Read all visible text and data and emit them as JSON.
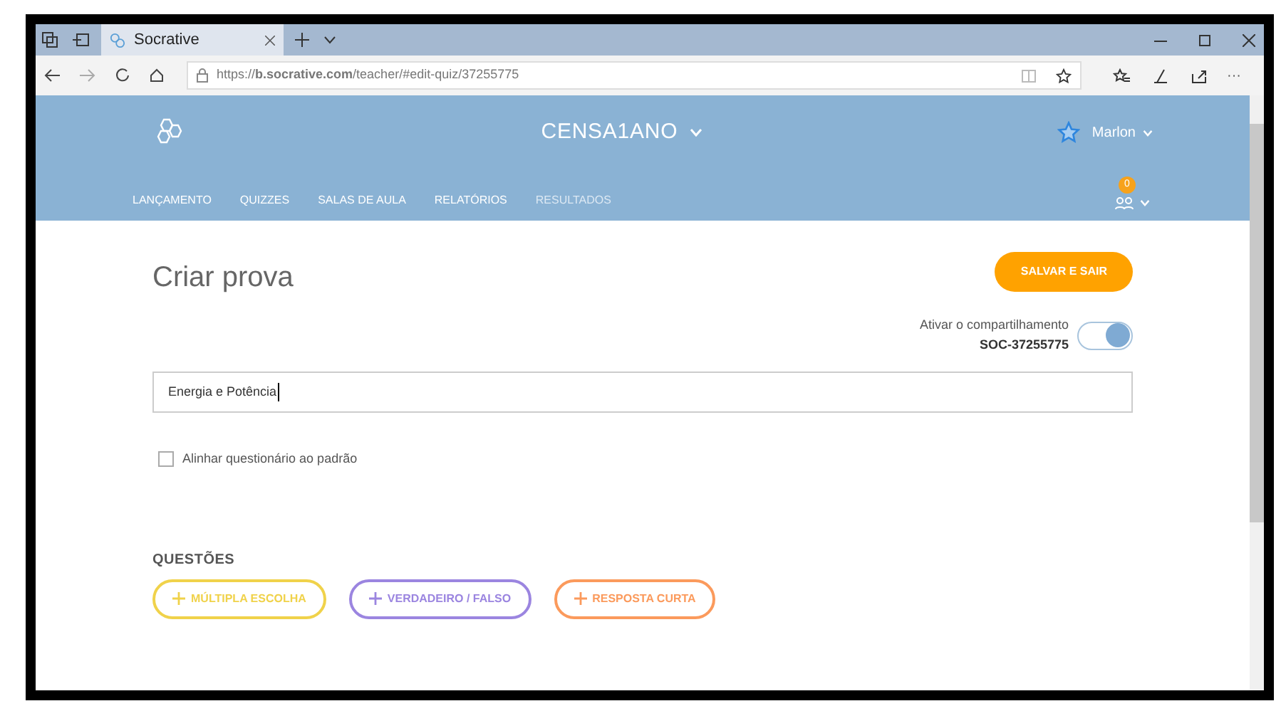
{
  "browser": {
    "tab_title": "Socrative",
    "url": "https://**b.socrative.com**/teacher/#edit-quiz/37255775",
    "more": "···"
  },
  "header": {
    "class_name": "CENSA1ANO",
    "user": "Marlon",
    "notification_count": "0"
  },
  "nav": [
    {
      "label": "LANÇAMENTO",
      "disabled": false
    },
    {
      "label": "QUIZZES",
      "disabled": false
    },
    {
      "label": "SALAS DE AULA",
      "disabled": false
    },
    {
      "label": "RELATÓRIOS",
      "disabled": false
    },
    {
      "label": "RESULTADOS",
      "disabled": true
    }
  ],
  "page": {
    "title": "Criar prova",
    "save_button": "SALVAR E SAIR",
    "sharing_label": "Ativar o compartilhamento",
    "sharing_code": "SOC-37255775",
    "sharing_on": true,
    "quiz_name": "Energia e Potência",
    "align_label": "Alinhar questionário ao padrão",
    "align_checked": false,
    "questions_heading": "QUESTÕES"
  },
  "question_types": [
    {
      "label": "MÚLTIPLA ESCOLHA",
      "color": "#f0d24a"
    },
    {
      "label": "VERDADEIRO / FALSO",
      "color": "#9b85e0"
    },
    {
      "label": "RESPOSTA CURTA",
      "color": "#fb9a5c"
    }
  ]
}
